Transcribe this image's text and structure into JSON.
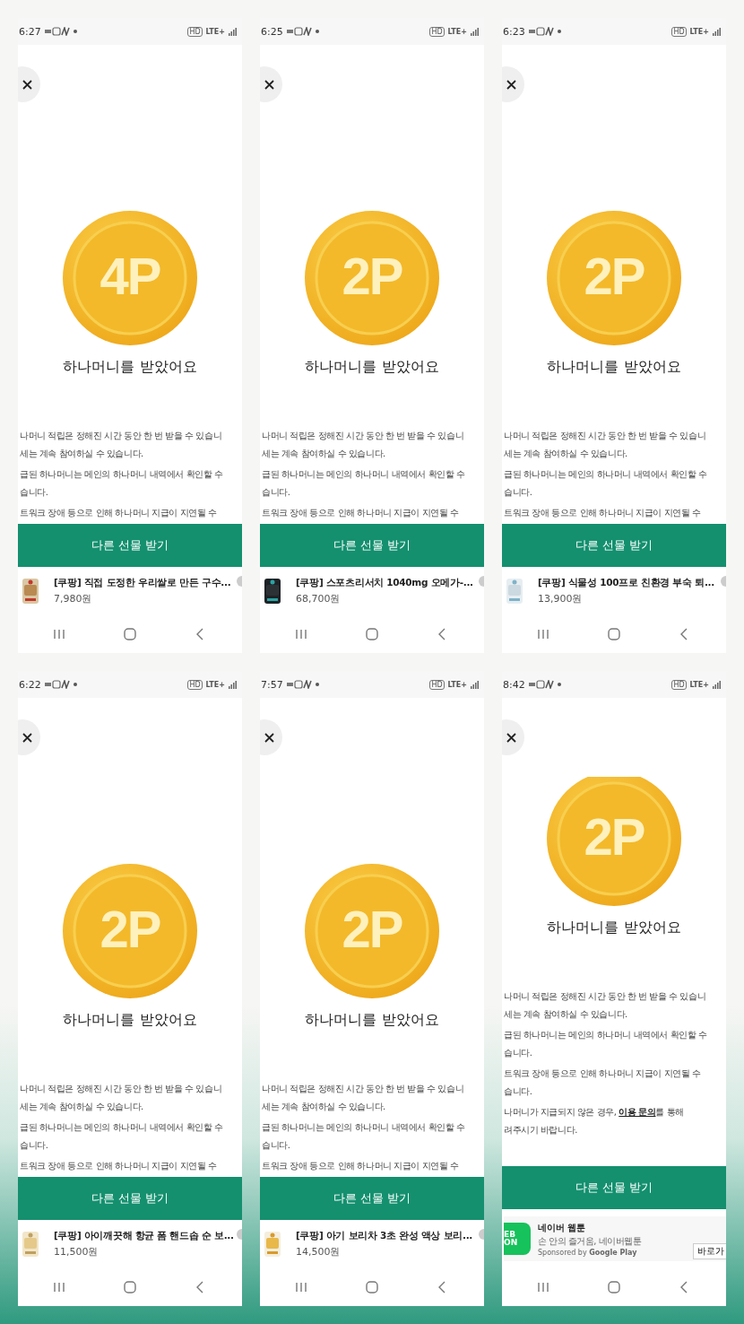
{
  "screens": [
    {
      "status": {
        "time": "6:27",
        "hd": "HD",
        "network": "LTE+"
      },
      "coin": {
        "label": "4P"
      },
      "title": "하나머니를 받았어요",
      "scrolled_to_end": false,
      "notices": [
        {
          "lines": [
            "나머니 적립은 정해진 시간 동안 한 번 받을 수 있습니",
            "세는 계속 참여하실 수 있습니다."
          ]
        },
        {
          "lines": [
            "급된 하나머니는 메인의 하나머니 내역에서 확인할 수",
            "습니다."
          ]
        },
        {
          "lines": [
            "트워크 장애 등으로 인해 하나머니 지급이 지연될 수"
          ]
        }
      ],
      "button": "다른 선물 받기",
      "promo": {
        "kind": "product",
        "title": "[쿠팡] 직접 도정한 우리쌀로 만든 구수...",
        "price": "7,980원"
      }
    },
    {
      "status": {
        "time": "6:25",
        "hd": "HD",
        "network": "LTE+"
      },
      "coin": {
        "label": "2P"
      },
      "title": "하나머니를 받았어요",
      "scrolled_to_end": false,
      "notices": [
        {
          "lines": [
            "나머니 적립은 정해진 시간 동안 한 번 받을 수 있습니",
            "세는 계속 참여하실 수 있습니다."
          ]
        },
        {
          "lines": [
            "급된 하나머니는 메인의 하나머니 내역에서 확인할 수",
            "습니다."
          ]
        },
        {
          "lines": [
            "트워크 장애 등으로 인해 하나머니 지급이 지연될 수"
          ]
        }
      ],
      "button": "다른 선물 받기",
      "promo": {
        "kind": "product",
        "title": "[쿠팡] 스포츠리서치 1040mg 오메가-...",
        "price": "68,700원"
      }
    },
    {
      "status": {
        "time": "6:23",
        "hd": "HD",
        "network": "LTE+"
      },
      "coin": {
        "label": "2P"
      },
      "title": "하나머니를 받았어요",
      "scrolled_to_end": false,
      "notices": [
        {
          "lines": [
            "나머니 적립은 정해진 시간 동안 한 번 받을 수 있습니",
            "세는 계속 참여하실 수 있습니다."
          ]
        },
        {
          "lines": [
            "급된 하나머니는 메인의 하나머니 내역에서 확인할 수",
            "습니다."
          ]
        },
        {
          "lines": [
            "트워크 장애 등으로 인해 하나머니 지급이 지연될 수"
          ]
        }
      ],
      "button": "다른 선물 받기",
      "promo": {
        "kind": "product",
        "title": "[쿠팡] 식물성 100프로 친환경 부숙 퇴...",
        "price": "13,900원"
      }
    },
    {
      "status": {
        "time": "6:22",
        "hd": "HD",
        "network": "LTE+"
      },
      "coin": {
        "label": "2P"
      },
      "title": "하나머니를 받았어요",
      "scrolled_to_end": false,
      "notices": [
        {
          "lines": [
            "나머니 적립은 정해진 시간 동안 한 번 받을 수 있습니",
            "세는 계속 참여하실 수 있습니다."
          ]
        },
        {
          "lines": [
            "급된 하나머니는 메인의 하나머니 내역에서 확인할 수",
            "습니다."
          ]
        },
        {
          "lines": [
            "트워크 장애 등으로 인해 하나머니 지급이 지연될 수"
          ]
        }
      ],
      "button": "다른 선물 받기",
      "promo": {
        "kind": "product",
        "title": "[쿠팡] 아이깨끗해 항균 폼 핸드솝 순 보...",
        "price": "11,500원"
      }
    },
    {
      "status": {
        "time": "7:57",
        "hd": "HD",
        "network": "LTE+"
      },
      "coin": {
        "label": "2P"
      },
      "title": "하나머니를 받았어요",
      "scrolled_to_end": false,
      "notices": [
        {
          "lines": [
            "나머니 적립은 정해진 시간 동안 한 번 받을 수 있습니",
            "세는 계속 참여하실 수 있습니다."
          ]
        },
        {
          "lines": [
            "급된 하나머니는 메인의 하나머니 내역에서 확인할 수",
            "습니다."
          ]
        },
        {
          "lines": [
            "트워크 장애 등으로 인해 하나머니 지급이 지연될 수"
          ]
        }
      ],
      "button": "다른 선물 받기",
      "promo": {
        "kind": "product",
        "title": "[쿠팡] 아기 보리차 3초 완성 액상 보리...",
        "price": "14,500원"
      }
    },
    {
      "status": {
        "time": "8:42",
        "hd": "HD",
        "network": "LTE+"
      },
      "coin": {
        "label": "2P"
      },
      "title": "하나머니를 받았어요",
      "scrolled_to_end": true,
      "notices": [
        {
          "lines": [
            "나머니 적립은 정해진 시간 동안 한 번 받을 수 있습니",
            "세는 계속 참여하실 수 있습니다."
          ]
        },
        {
          "lines": [
            "급된 하나머니는 메인의 하나머니 내역에서 확인할 수",
            "습니다."
          ]
        },
        {
          "lines": [
            "트워크 장애 등으로 인해 하나머니 지급이 지연될 수",
            "습니다."
          ]
        },
        {
          "lines": [
            "나머니가 지급되지 않은 경우, ",
            "려주시기 바랍니다."
          ],
          "link": {
            "text": "이용 문의",
            "after": "를 통해"
          }
        }
      ],
      "button": "다른 선물 받기",
      "promo": {
        "kind": "ad",
        "logo": [
          "EB",
          "ON"
        ],
        "title": "네이버 웹툰",
        "subtitle": "손 안의 즐거움, 네이버웹툰",
        "sponsor": "Sponsored by **Google Play**",
        "action": "바로가"
      }
    }
  ]
}
